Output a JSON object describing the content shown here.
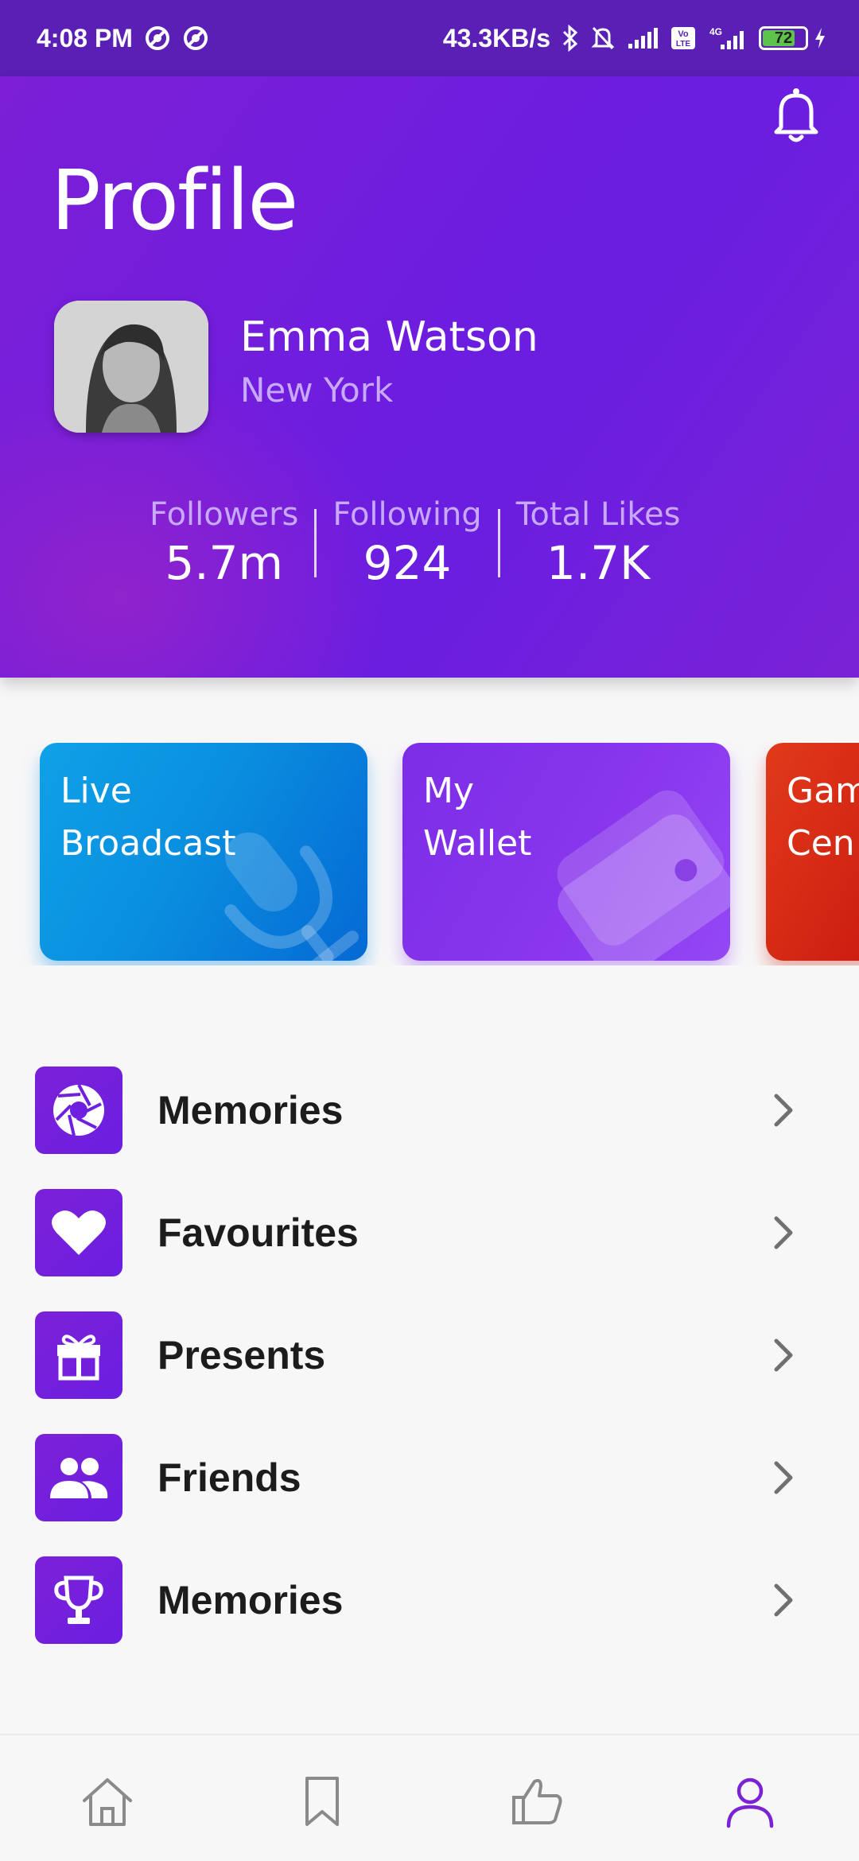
{
  "status_bar": {
    "time": "4:08 PM",
    "speed": "43.3KB/s",
    "battery": "72",
    "icons": [
      "vpn-icon",
      "vpn-icon",
      "bluetooth-icon",
      "bell-off-icon",
      "signal-icon",
      "volte-icon",
      "signal-4g-icon",
      "battery-icon",
      "charging-icon"
    ]
  },
  "header": {
    "title": "Profile",
    "bell_icon": "bell-icon",
    "user": {
      "name": "Emma Watson",
      "location": "New York"
    },
    "stats": [
      {
        "label": "Followers",
        "value": "5.7m"
      },
      {
        "label": "Following",
        "value": "924"
      },
      {
        "label": "Total Likes",
        "value": "1.7K"
      }
    ]
  },
  "cards": [
    {
      "line1": "Live",
      "line2": "Broadcast",
      "icon": "microphone-icon",
      "color": "#0a8fdf"
    },
    {
      "line1": "My",
      "line2": "Wallet",
      "icon": "wallet-icon",
      "color": "#8a37ee"
    },
    {
      "line1": "Gam",
      "line2": "Cen",
      "icon": "",
      "color": "#c8170f"
    }
  ],
  "menu": [
    {
      "label": "Memories",
      "icon": "aperture-icon"
    },
    {
      "label": "Favourites",
      "icon": "heart-icon"
    },
    {
      "label": "Presents",
      "icon": "gift-icon"
    },
    {
      "label": "Friends",
      "icon": "people-icon"
    },
    {
      "label": "Memories",
      "icon": "trophy-icon"
    }
  ],
  "bottom_nav": {
    "items": [
      "home-icon",
      "bookmark-icon",
      "thumbs-up-icon",
      "profile-icon"
    ],
    "active": "profile-icon",
    "accent": "#7b23d4"
  }
}
